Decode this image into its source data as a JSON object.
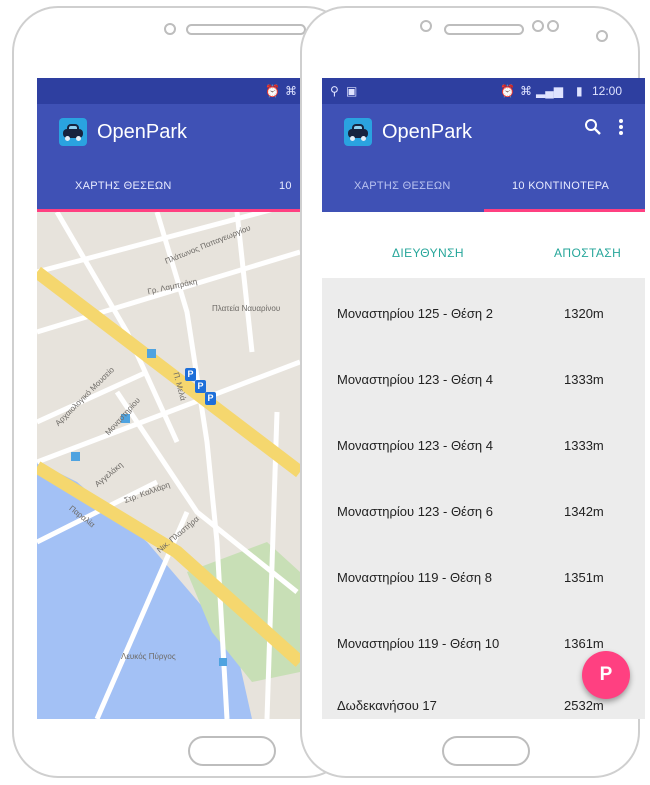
{
  "app": {
    "name": "OpenPark"
  },
  "status_bar": {
    "time": "12:00"
  },
  "tabs": [
    {
      "label": "ΧΑΡΤΗΣ ΘΕΣΕΩΝ"
    },
    {
      "label": "10 ΚΟΝΤΙΝΟΤΕΡΑ"
    }
  ],
  "left_screen": {
    "tab_partial": "10"
  },
  "map": {
    "labels": [
      "Πλάτωνος Παπαγεωργίου",
      "Π. Μελά",
      "Γρ. Λαμπράκη",
      "Πλατεία Ναυαρίνου",
      "Μοναστηρίου",
      "Αγγελάκη",
      "Στρ. Καλλάρη",
      "Παραλία",
      "Νικ. Πλαστήρα",
      "Αρχαιολογικό Μουσείο",
      "Λευκός Πύργος"
    ]
  },
  "list": {
    "header_address": "ΔΙΕΥΘΥΝΣΗ",
    "header_distance": "ΑΠΟΣΤΑΣΗ",
    "rows": [
      {
        "address": "Μοναστηρίου 125 - Θέση 2",
        "distance": "1320m"
      },
      {
        "address": "Μοναστηρίου 123 - Θέση 4",
        "distance": "1333m"
      },
      {
        "address": "Μοναστηρίου 123 - Θέση 4",
        "distance": "1333m"
      },
      {
        "address": "Μοναστηρίου 123 - Θέση 6",
        "distance": "1342m"
      },
      {
        "address": "Μοναστηρίου 119 - Θέση 8",
        "distance": "1351m"
      },
      {
        "address": "Μοναστηρίου 119 - Θέση 10",
        "distance": "1361m"
      },
      {
        "address": "Δωδεκανήσου 17",
        "distance": "2532m"
      }
    ]
  },
  "fab": {
    "label": "P"
  },
  "colors": {
    "primary": "#3f51b5",
    "status": "#2e3fa0",
    "accent": "#ff4081",
    "header_text": "#26a69a"
  },
  "icons": [
    "car-logo-icon",
    "search-icon",
    "more-vert-icon",
    "location-icon",
    "alarm-icon",
    "wifi-icon",
    "signal-icon",
    "battery-icon",
    "parking-pin-icon"
  ]
}
